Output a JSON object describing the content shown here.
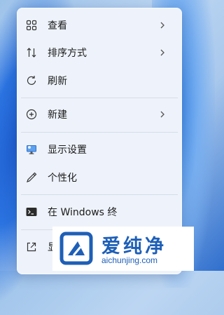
{
  "context_menu": {
    "items": [
      {
        "label": "查看",
        "icon": "grid-icon",
        "submenu": true
      },
      {
        "label": "排序方式",
        "icon": "sort-icon",
        "submenu": true
      },
      {
        "label": "刷新",
        "icon": "refresh-icon",
        "submenu": false
      },
      {
        "label": "新建",
        "icon": "new-plus-icon",
        "submenu": true
      },
      {
        "label": "显示设置",
        "icon": "display-icon",
        "submenu": false
      },
      {
        "label": "个性化",
        "icon": "pen-icon",
        "submenu": false
      },
      {
        "label": "在 Windows 终",
        "icon": "terminal-icon",
        "submenu": false
      },
      {
        "label": "显",
        "icon": "share-icon",
        "submenu": false
      }
    ]
  },
  "watermark": {
    "text": "爱纯净",
    "url": "aichunjing.com"
  },
  "colors": {
    "menu_bg": "#eef3fb",
    "accent": "#1e5fb7",
    "separator": "#d6dce6"
  }
}
